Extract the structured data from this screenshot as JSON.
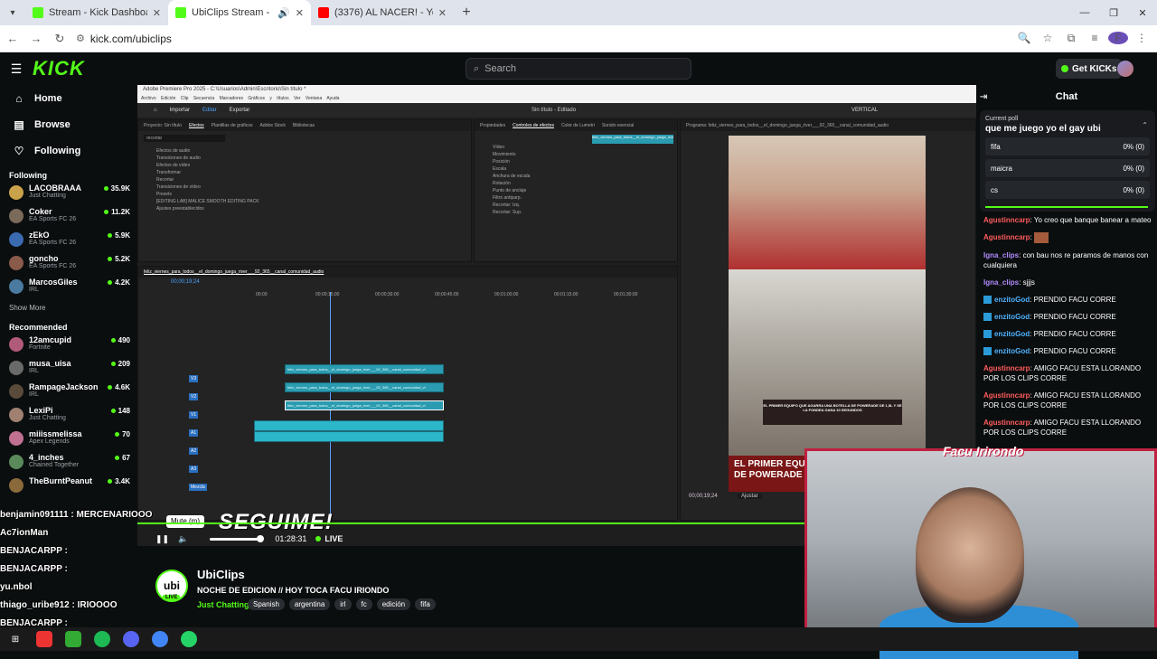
{
  "browser": {
    "tabs": [
      {
        "title": "Stream - Kick Dashboard",
        "color": "#53fc18"
      },
      {
        "title": "UbiClips Stream - Watch Li",
        "color": "#53fc18"
      },
      {
        "title": "(3376) AL NACER! - YouTube",
        "color": "#ff0000"
      }
    ],
    "url": "kick.com/ubiclips"
  },
  "kick": {
    "logo": "KICK",
    "search_placeholder": "Search",
    "get_kicks": "Get KICKs"
  },
  "sidebar": {
    "nav": [
      {
        "label": "Home",
        "icon": "home-icon"
      },
      {
        "label": "Browse",
        "icon": "browse-icon"
      },
      {
        "label": "Following",
        "icon": "heart-icon"
      }
    ],
    "following_title": "Following",
    "following": [
      {
        "name": "LACOBRAAA",
        "cat": "Just Chatting",
        "viewers": "35.9K",
        "color": "#c9a24a"
      },
      {
        "name": "Coker",
        "cat": "EA Sports FC 26",
        "viewers": "11.2K",
        "color": "#7a6a5a"
      },
      {
        "name": "zEkO",
        "cat": "EA Sports FC 26",
        "viewers": "5.9K",
        "color": "#3a6ab0"
      },
      {
        "name": "goncho",
        "cat": "EA Sports FC 26",
        "viewers": "5.2K",
        "color": "#8a5a4a"
      },
      {
        "name": "MarcosGiles",
        "cat": "IRL",
        "viewers": "4.2K",
        "color": "#4a7aa0"
      }
    ],
    "show_more": "Show More",
    "recommended_title": "Recommended",
    "recommended": [
      {
        "name": "12amcupid",
        "cat": "Fortnite",
        "viewers": "490",
        "color": "#b05a7a"
      },
      {
        "name": "musa_uisa",
        "cat": "IRL",
        "viewers": "209",
        "color": "#6a6a6a"
      },
      {
        "name": "RampageJackson",
        "cat": "IRL",
        "viewers": "4.6K",
        "color": "#5a4a3a"
      },
      {
        "name": "LexiPi",
        "cat": "Just Chatting",
        "viewers": "148",
        "color": "#a08070"
      },
      {
        "name": "miiissmelissa",
        "cat": "Apex Legends",
        "viewers": "70",
        "color": "#c07090"
      },
      {
        "name": "4_inches",
        "cat": "Chained Together",
        "viewers": "67",
        "color": "#5a8a5a"
      },
      {
        "name": "TheBurntPeanut",
        "cat": "",
        "viewers": "3.4K",
        "color": "#8a6a3a"
      }
    ]
  },
  "premiere": {
    "window_title": "Adobe Premiere Pro 2025 - C:\\Usuarios\\Admin\\Escritorio\\Sin título *",
    "menu": "Archivo Edición Clip Secuencia Marcadores Gráficos y títulos Ver Ventana Ayuda",
    "tabs": [
      "Importar",
      "Editar",
      "Exportar"
    ],
    "doc_title": "Sin título - Editado",
    "effects_tabs": [
      "Proyecto: Sin título",
      "Efectos",
      "Plantillas de gráficos",
      "Adobe Stock",
      "Bibliotecas"
    ],
    "search_value": "recortar",
    "effects_tree": [
      "Efectos de audio",
      "Transiciones de audio",
      "Efectos de vídeo",
      "Transformar",
      "Recortar",
      "Transiciones de vídeo",
      "Presets",
      "[EDITING LAB] MALICE SMOOTH EDITING PACK",
      "Ajustes preestablecidos"
    ],
    "controls_tabs": [
      "Propiedades",
      "Controles de efectos",
      "Color de Lumetri",
      "Sonido esencial"
    ],
    "fx_rows": [
      "Vídeo",
      "Movimiento",
      "Posición",
      "Escala",
      "Anchura de escala",
      "Rotación",
      "Punto de anclaje",
      "Filtro antiparp.",
      "Recortar: Izq.",
      "Recortar: Sup."
    ],
    "sequence_name": "feliz_viernes_para_todos__el_domingo_juega_river___92_365__canal_comunidad_audio",
    "timecode": "00;00;19;24",
    "ruler": [
      "00;00",
      "00;00;15;00",
      "00;00;30;00",
      "00;00;45;00",
      "00;01;00;00",
      "00;01;15;00",
      "00;01;30;00"
    ],
    "tracks": [
      "V3",
      "V2",
      "V1",
      "A1",
      "A2",
      "A3",
      "Mezcla"
    ],
    "clip_name": "feliz_viernes_para_todos__el_domingo_juega_river___92_365__canal_comunidad_vi",
    "program_label": "Programa: feliz_viernes_para_todos__el_domingo_juega_river___92_365__canal_comunidad_audio",
    "program_time": "00;00;19;24",
    "fit": "Ajustar",
    "vertical": "VERTICAL",
    "cam_caption": "EL PRIMER EQUIPO QUE AGARRA UNA BOTELLA DE POWERADE DE 1,5L Y SE LA FONDEA GANA 10 SEGUNDOS",
    "big_caption_1": "EL PRIMER EQUIP",
    "big_caption_2": "DE POWERADE"
  },
  "player": {
    "overlay_text": "SEGUIME!",
    "tooltip": "Mute (m)",
    "time": "01:28:31",
    "live": "LIVE",
    "volume_fraction": 0.9
  },
  "webcam": {
    "label": "Facu Irirondo"
  },
  "channel": {
    "name": "UbiClips",
    "logo_text": "ubi",
    "live_badge": "LIVE",
    "title": "NOCHE DE EDICION // HOY TOCA FACU IRIONDO",
    "category": "Just Chatting",
    "tags": [
      "Spanish",
      "argentina",
      "irl",
      "fc",
      "edición",
      "fifa"
    ]
  },
  "chat": {
    "title": "Chat",
    "poll": {
      "label": "Current poll",
      "question": "que me juego yo el gay ubi",
      "options": [
        {
          "label": "fifa",
          "value": "0% (0)"
        },
        {
          "label": "maicra",
          "value": "0% (0)"
        },
        {
          "label": "cs",
          "value": "0% (0)"
        }
      ]
    },
    "messages": [
      {
        "user": "Agustinncarp",
        "text": "Yo creo que banque banear a mateo",
        "color": "u-red",
        "badge": false,
        "emote": false
      },
      {
        "user": "Agustinncarp",
        "text": "",
        "color": "u-red",
        "badge": false,
        "emote": true
      },
      {
        "user": "Igna_clips",
        "text": "con bau nos re paramos de manos con cualquiera",
        "color": "u-purple",
        "badge": false,
        "emote": false
      },
      {
        "user": "Igna_clips",
        "text": "sjjjs",
        "color": "u-purple",
        "badge": false,
        "emote": false
      },
      {
        "user": "enzitoGod",
        "text": "PRENDIO FACU CORRE",
        "color": "u-blue",
        "badge": true,
        "emote": false
      },
      {
        "user": "enzitoGod",
        "text": "PRENDIO FACU CORRE",
        "color": "u-blue",
        "badge": true,
        "emote": false
      },
      {
        "user": "enzitoGod",
        "text": "PRENDIO FACU CORRE",
        "color": "u-blue",
        "badge": true,
        "emote": false
      },
      {
        "user": "enzitoGod",
        "text": "PRENDIO FACU CORRE",
        "color": "u-blue",
        "badge": true,
        "emote": false
      },
      {
        "user": "Agustinncarp",
        "text": "AMIGO FACU ESTA LLORANDO POR LOS CLIPS CORRE",
        "color": "u-red",
        "badge": false,
        "emote": false
      },
      {
        "user": "Agustinncarp",
        "text": "AMIGO FACU ESTA LLORANDO POR LOS CLIPS CORRE",
        "color": "u-red",
        "badge": false,
        "emote": false
      },
      {
        "user": "Agustinncarp",
        "text": "AMIGO FACU ESTA LLORANDO POR LOS CLIPS CORRE",
        "color": "u-red",
        "badge": false,
        "emote": false
      }
    ]
  },
  "overlay_chat": [
    "benjamin091111 : MERCENARIOOO",
    "Ac7ionMan",
    "BENJACARPP :",
    "BENJACARPP :",
    "yu.nbol",
    "thiago_uribe912 : IRIOOOO",
    "BENJACARPP :",
    "BENJACARPP :"
  ]
}
